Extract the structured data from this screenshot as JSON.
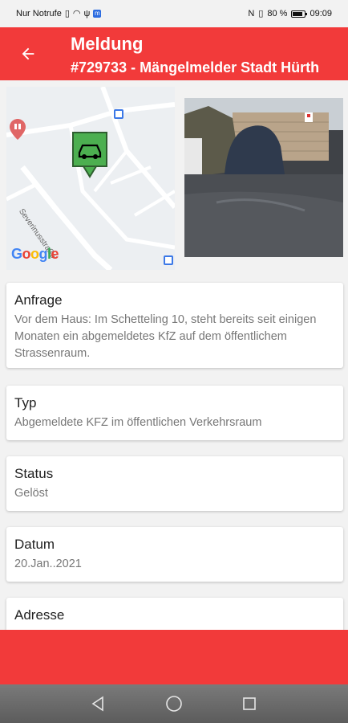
{
  "status_bar": {
    "carrier": "Nur Notrufe",
    "battery": "80 %",
    "time": "09:09"
  },
  "app_bar": {
    "title": "Meldung",
    "subtitle": "#729733 - Mängelmelder Stadt Hürth",
    "background": "#f23a3a"
  },
  "map": {
    "street_label": "Severinusstraße",
    "google_label": "Google",
    "marker_color": "#4caf50"
  },
  "cards": [
    {
      "label": "Anfrage",
      "value": "Vor dem Haus: Im Schetteling 10, steht bereits seit einigen Monaten ein abgemeldetes KfZ auf dem öffentlichem Strassenraum."
    },
    {
      "label": "Typ",
      "value": "Abgemeldete KFZ im öffentlichen Verkehrsraum"
    },
    {
      "label": "Status",
      "value": "Gelöst"
    },
    {
      "label": "Datum",
      "value": "20.Jan..2021"
    },
    {
      "label": "Adresse",
      "value": ""
    }
  ],
  "icons": {
    "back": "arrow-left-icon",
    "nav_back": "triangle-back-icon",
    "nav_home": "circle-home-icon",
    "nav_recent": "square-recent-icon"
  }
}
